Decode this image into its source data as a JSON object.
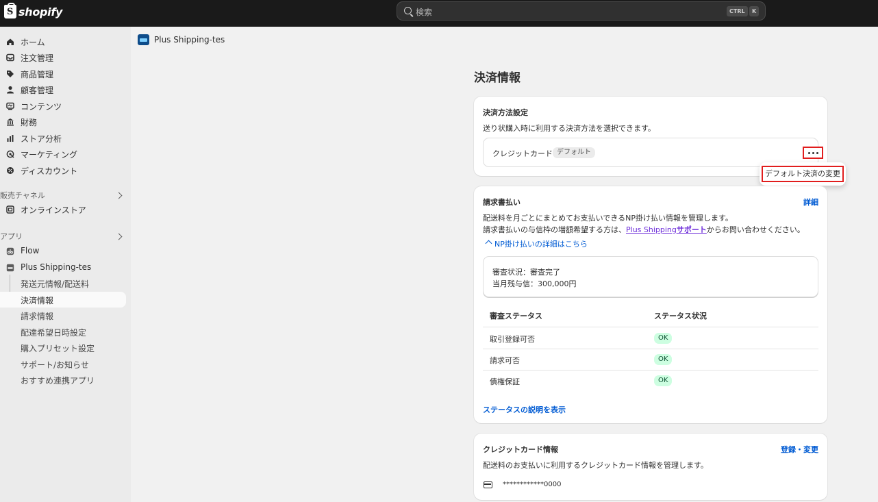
{
  "topbar": {
    "brand": "shopify",
    "search_placeholder": "検索",
    "kbd_ctrl": "CTRL",
    "kbd_k": "K"
  },
  "sidebar": {
    "items": [
      {
        "label": "ホーム",
        "icon": "home-icon"
      },
      {
        "label": "注文管理",
        "icon": "inbox-icon"
      },
      {
        "label": "商品管理",
        "icon": "tag-icon"
      },
      {
        "label": "顧客管理",
        "icon": "person-icon"
      },
      {
        "label": "コンテンツ",
        "icon": "content-icon"
      },
      {
        "label": "財務",
        "icon": "bank-icon"
      },
      {
        "label": "ストア分析",
        "icon": "chart-bar-icon"
      },
      {
        "label": "マーケティング",
        "icon": "target-icon"
      },
      {
        "label": "ディスカウント",
        "icon": "discount-gear-icon"
      }
    ],
    "sales_channels_label": "販売チャネル",
    "online_store": "オンラインストア",
    "apps_label": "アプリ",
    "flow": "Flow",
    "plus_shipping": "Plus Shipping-tes",
    "subitems": [
      "発送元情報/配送料",
      "決済情報",
      "請求情報",
      "配達希望日時設定",
      "購入プリセット設定",
      "サポート/お知らせ",
      "おすすめ連携アプリ"
    ]
  },
  "app": {
    "title": "Plus Shipping-tes"
  },
  "page_title": "決済情報",
  "payment_settings": {
    "title": "決済方法設定",
    "description": "送り状購入時に利用する決済方法を選択できます。",
    "method": "クレジットカード",
    "badge": "デフォルト",
    "menu_item": "デフォルト決済の変更"
  },
  "invoice": {
    "title": "請求書払い",
    "detail_link": "詳細",
    "desc1": "配送料を月ごとにまとめてお支払いできるNP掛け払い情報を管理します。",
    "desc2_pre": "請求書払いの与信枠の増額希望する方は、",
    "desc2_link1": "Plus Shipping",
    "desc2_link2": "サポート",
    "desc2_post": "からお問い合わせください。",
    "np_link": "NP掛け払いの詳細はこちら",
    "review_status_line": "審査状況：審査完了",
    "credit_line": "当月残与信：300,000円",
    "col1": "審査ステータス",
    "col2": "ステータス状況",
    "rows": [
      {
        "name": "取引登録可否",
        "status": "OK"
      },
      {
        "name": "請求可否",
        "status": "OK"
      },
      {
        "name": "債権保証",
        "status": "OK"
      }
    ],
    "status_link": "ステータスの説明を表示"
  },
  "credit_card": {
    "title": "クレジットカード情報",
    "link": "登録・変更",
    "description": "配送料のお支払いに利用するクレジットカード情報を管理します。",
    "masked_number": "************0000"
  },
  "colors": {
    "accent": "#005bd3",
    "highlight": "#e11d1d",
    "ok_bg": "#cdfee1",
    "topbar": "#1a1a1a"
  }
}
